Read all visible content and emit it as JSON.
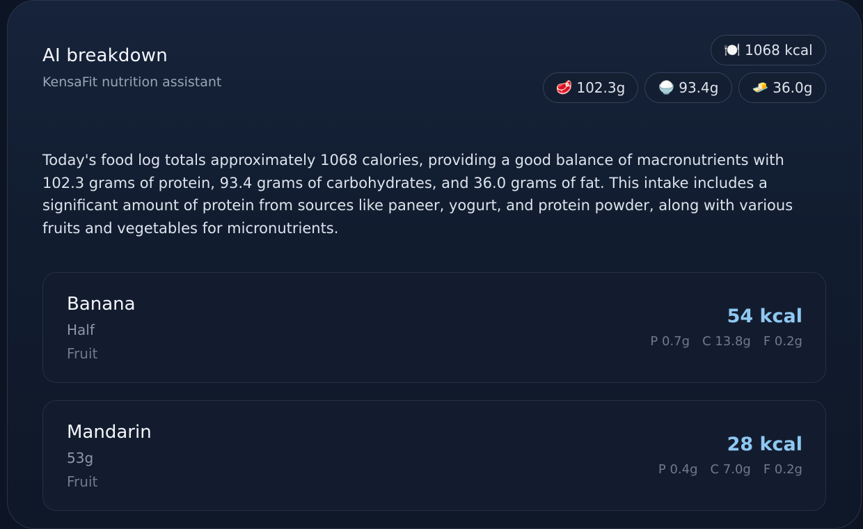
{
  "header": {
    "title": "AI breakdown",
    "subtitle": "KensaFit nutrition assistant"
  },
  "totals": {
    "calories": {
      "icon": "plate-cutlery-icon",
      "glyph": "🍽️",
      "value": "1068 kcal"
    },
    "protein": {
      "icon": "meat-icon",
      "glyph": "🥩",
      "value": "102.3g"
    },
    "carbs": {
      "icon": "rice-bowl-icon",
      "glyph": "🍚",
      "value": "93.4g"
    },
    "fat": {
      "icon": "butter-icon",
      "glyph": "🧈",
      "value": "36.0g"
    }
  },
  "summary": "Today's food log totals approximately 1068 calories, providing a good balance of macronutrients with 102.3 grams of protein, 93.4 grams of carbohydrates, and 36.0 grams of fat. This intake includes a significant amount of protein from sources like paneer, yogurt, and protein powder, along with various fruits and vegetables for micronutrients.",
  "items": [
    {
      "name": "Banana",
      "amount": "Half",
      "category": "Fruit",
      "kcal": "54 kcal",
      "protein": "P 0.7g",
      "carbs": "C 13.8g",
      "fat": "F 0.2g"
    },
    {
      "name": "Mandarin",
      "amount": "53g",
      "category": "Fruit",
      "kcal": "28 kcal",
      "protein": "P 0.4g",
      "carbs": "C 7.0g",
      "fat": "F 0.2g"
    }
  ],
  "colors": {
    "background": "#0d1524",
    "panel": "#16233a",
    "accent_kcal": "#8fc8f2",
    "text_primary": "#f3f5f9",
    "text_muted": "#6f7a8d"
  }
}
